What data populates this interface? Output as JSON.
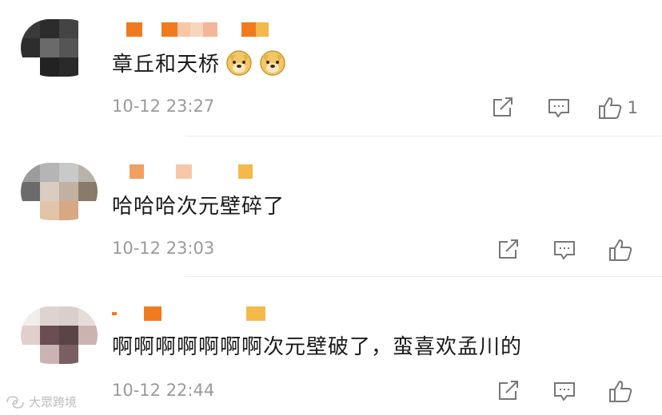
{
  "comments": [
    {
      "content": "章丘和天桥",
      "emojis": [
        "doge-icon",
        "doge-icon"
      ],
      "time": "10-12 23:27",
      "like_count": "1"
    },
    {
      "content": "哈哈哈次元壁碎了",
      "emojis": [],
      "time": "10-12 23:03",
      "like_count": ""
    },
    {
      "content": "啊啊啊啊啊啊啊次元壁破了，蛮喜欢孟川的",
      "emojis": [],
      "time": "10-12 22:44",
      "like_count": ""
    }
  ],
  "watermark": "大眾跨境",
  "colors": {
    "text": "#1a1a1a",
    "meta": "#9a9a9a",
    "icon": "#777777",
    "username_orange": "#f07b1f",
    "username_peach": "#f7c7a8",
    "username_yellow": "#f5b84a"
  }
}
